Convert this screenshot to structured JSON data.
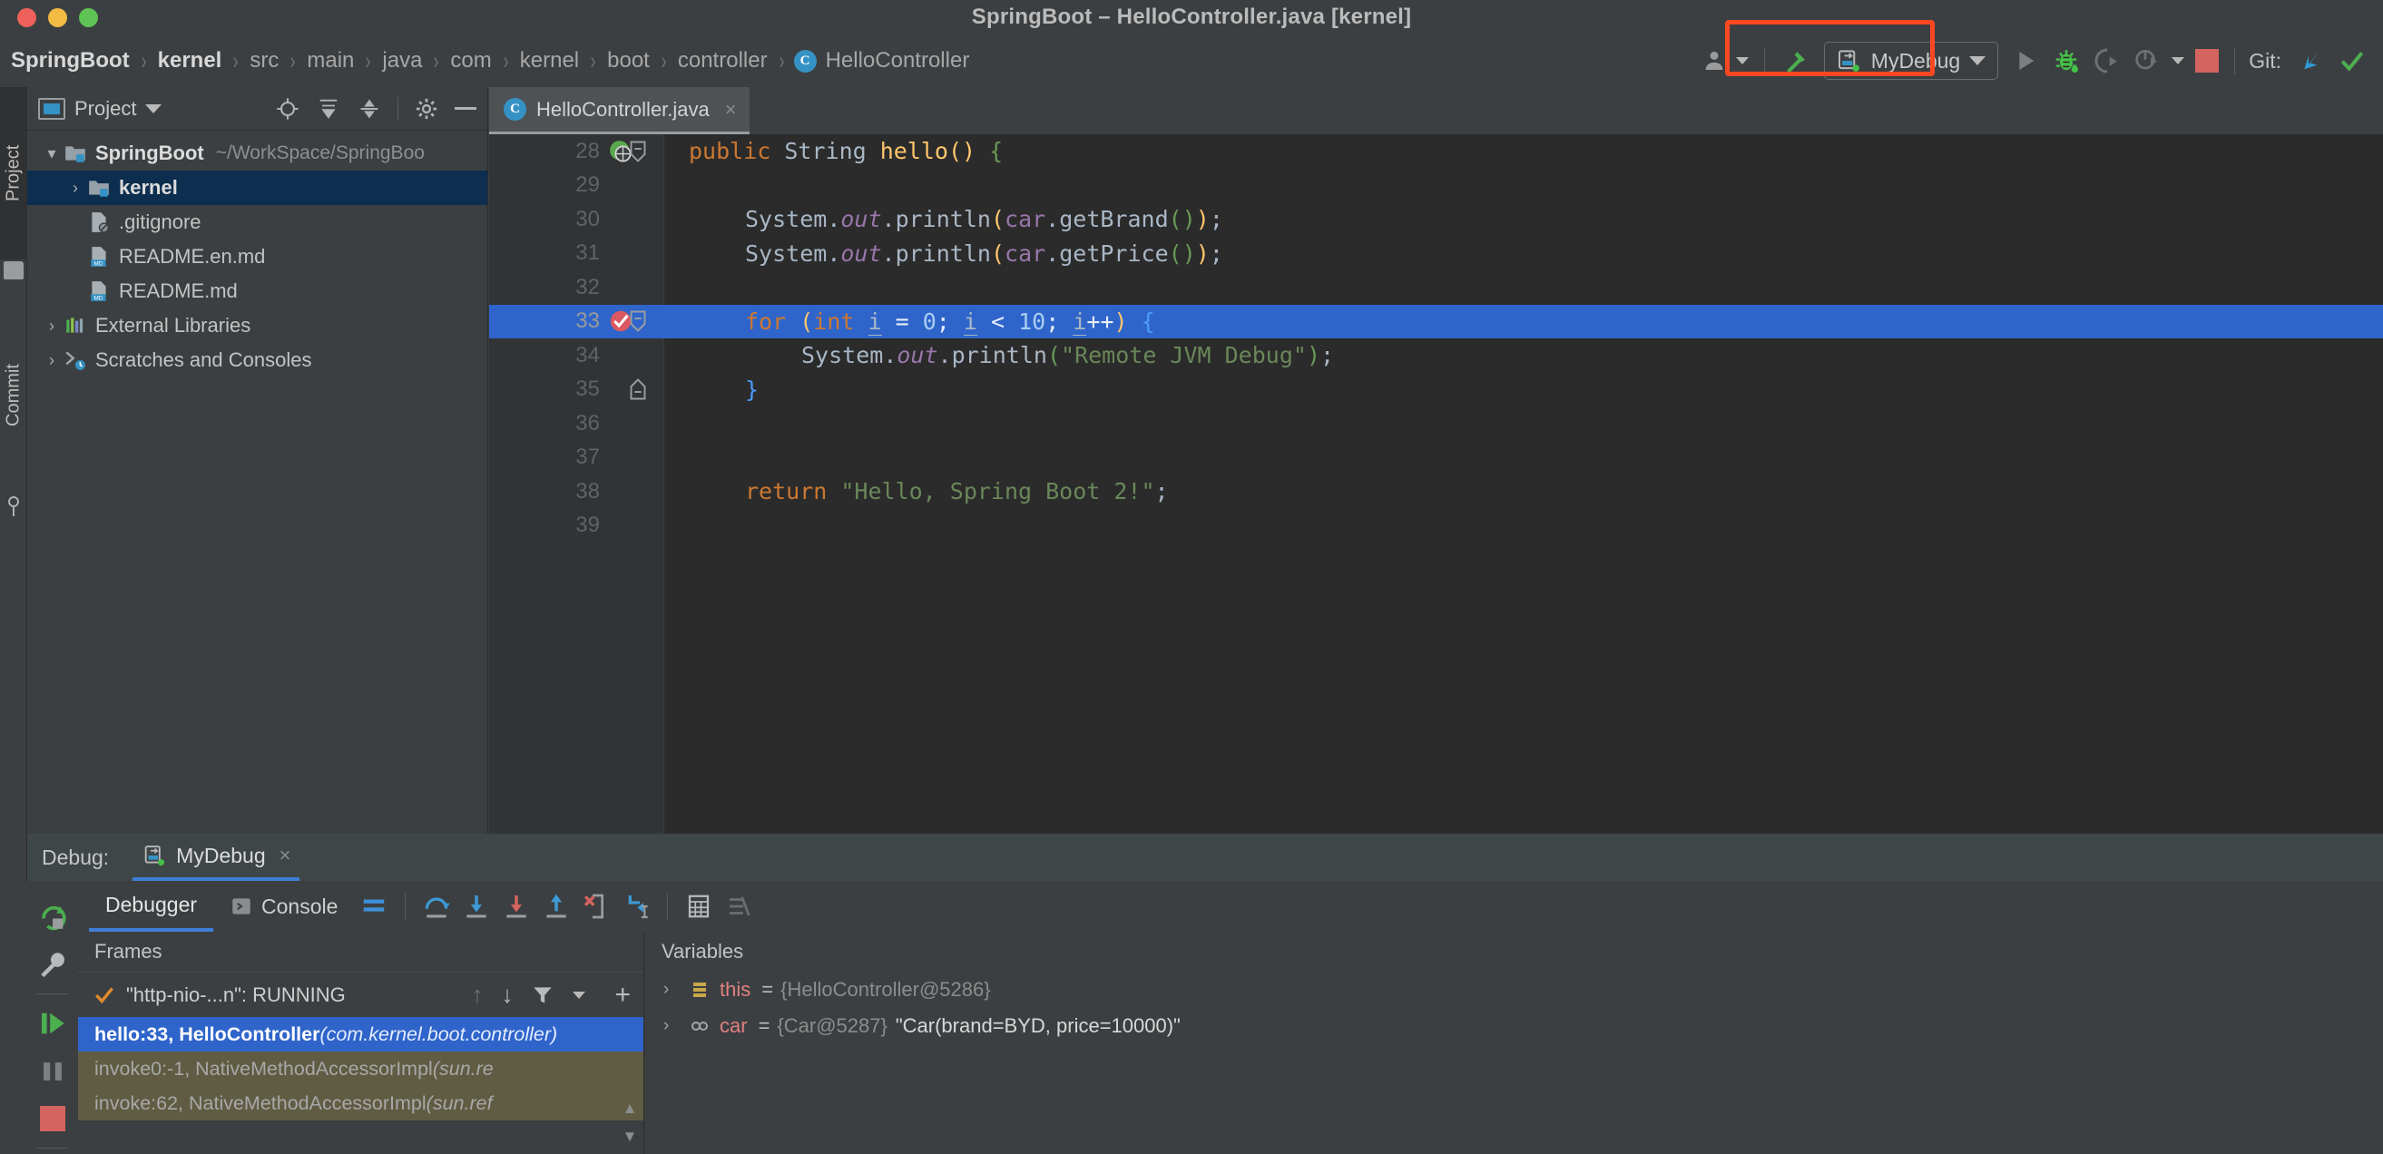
{
  "window": {
    "title": "SpringBoot – HelloController.java [kernel]",
    "traffic_lights": [
      "close-red",
      "minimize-yellow",
      "maximize-green"
    ]
  },
  "breadcrumb": {
    "separator": "›",
    "items": [
      {
        "label": "SpringBoot",
        "strong": true
      },
      {
        "label": "kernel",
        "strong": true
      },
      {
        "label": "src",
        "strong": false
      },
      {
        "label": "main",
        "strong": false
      },
      {
        "label": "java",
        "strong": false
      },
      {
        "label": "com",
        "strong": false
      },
      {
        "label": "kernel",
        "strong": false
      },
      {
        "label": "boot",
        "strong": false
      },
      {
        "label": "controller",
        "strong": false
      },
      {
        "label": "HelloController",
        "strong": false,
        "badge": "C"
      }
    ]
  },
  "toolbar": {
    "icons": [
      "user-avatar-icon",
      "chevron-down-icon",
      "build-hammer-icon"
    ],
    "run_config": {
      "name": "MyDebug",
      "icon": "remote-jvm-debug-icon",
      "dropdown": "chevron-down-icon"
    },
    "run_button": "run-icon",
    "debug_button": "debug-bug-icon",
    "run_with_coverage_button": "run-coverage-icon",
    "profiler_button": "profiler-icon",
    "profiler_dropdown": "chevron-down-icon",
    "stop_button": "stop-icon",
    "git": {
      "label": "Git:",
      "update_project": "update-project-icon",
      "commit_check": "commit-check-icon"
    },
    "annotation_box_color": "#fb4722"
  },
  "left_strip": {
    "tabs": [
      {
        "label": "Project",
        "icon": "folder-icon",
        "active": true
      },
      {
        "label": "Commit",
        "icon": "commit-icon",
        "active": false
      }
    ]
  },
  "project_panel": {
    "title": "Project",
    "title_icon": "project-view-icon",
    "title_dropdown": "chevron-down-icon",
    "actions": [
      "locate-target-icon",
      "expand-all-icon",
      "collapse-all-icon",
      "gear-icon",
      "hide-minus-icon"
    ],
    "tree": [
      {
        "indent": 0,
        "arrow": "expanded",
        "icon": "module-folder-icon",
        "name": "SpringBoot",
        "bold": true,
        "path": "~/WorkSpace/SpringBoo",
        "selected": false
      },
      {
        "indent": 1,
        "arrow": "collapsed",
        "icon": "module-folder-icon",
        "name": "kernel",
        "bold": true,
        "path": "",
        "selected": true
      },
      {
        "indent": 1,
        "arrow": "none",
        "icon": "gitignore-file-icon",
        "name": ".gitignore",
        "bold": false,
        "path": "",
        "selected": false
      },
      {
        "indent": 1,
        "arrow": "none",
        "icon": "markdown-file-icon",
        "name": "README.en.md",
        "bold": false,
        "path": "",
        "selected": false
      },
      {
        "indent": 1,
        "arrow": "none",
        "icon": "markdown-file-icon",
        "name": "README.md",
        "bold": false,
        "path": "",
        "selected": false
      },
      {
        "indent": 0,
        "arrow": "collapsed",
        "icon": "external-libraries-icon",
        "name": "External Libraries",
        "bold": false,
        "path": "",
        "selected": false
      },
      {
        "indent": 0,
        "arrow": "collapsed",
        "icon": "scratches-icon",
        "name": "Scratches and Consoles",
        "bold": false,
        "path": "",
        "selected": false
      }
    ]
  },
  "editor": {
    "tab": {
      "label": "HelloController.java",
      "badge": "C",
      "close": "×"
    },
    "lines": [
      {
        "no": "28",
        "indent": 0,
        "highlight": false,
        "gutter_icon": "web-endpoint-icon",
        "fold": "fold-collapse-icon",
        "tokens": [
          {
            "t": "public ",
            "c": "kw"
          },
          {
            "t": "String ",
            "c": "pln"
          },
          {
            "t": "hello",
            "c": "mth"
          },
          {
            "t": "()",
            "c": "br-y"
          },
          {
            "t": " ",
            "c": "pln"
          },
          {
            "t": "{",
            "c": "br-g"
          }
        ]
      },
      {
        "no": "29",
        "indent": 0,
        "highlight": false,
        "gutter_icon": "",
        "fold": "",
        "tokens": []
      },
      {
        "no": "30",
        "indent": 1,
        "highlight": false,
        "gutter_icon": "",
        "fold": "",
        "tokens": [
          {
            "t": "System",
            "c": "pln"
          },
          {
            "t": ".",
            "c": "pln"
          },
          {
            "t": "out",
            "c": "fld"
          },
          {
            "t": ".println",
            "c": "pln"
          },
          {
            "t": "(",
            "c": "br-y"
          },
          {
            "t": "car",
            "c": "id"
          },
          {
            "t": ".getBrand",
            "c": "pln"
          },
          {
            "t": "()",
            "c": "br-g"
          },
          {
            "t": ")",
            "c": "br-y"
          },
          {
            "t": ";",
            "c": "pln"
          }
        ]
      },
      {
        "no": "31",
        "indent": 1,
        "highlight": false,
        "gutter_icon": "",
        "fold": "",
        "tokens": [
          {
            "t": "System",
            "c": "pln"
          },
          {
            "t": ".",
            "c": "pln"
          },
          {
            "t": "out",
            "c": "fld"
          },
          {
            "t": ".println",
            "c": "pln"
          },
          {
            "t": "(",
            "c": "br-y"
          },
          {
            "t": "car",
            "c": "id"
          },
          {
            "t": ".getPrice",
            "c": "pln"
          },
          {
            "t": "()",
            "c": "br-g"
          },
          {
            "t": ")",
            "c": "br-y"
          },
          {
            "t": ";",
            "c": "pln"
          }
        ]
      },
      {
        "no": "32",
        "indent": 0,
        "highlight": false,
        "gutter_icon": "",
        "fold": "",
        "tokens": []
      },
      {
        "no": "33",
        "indent": 1,
        "highlight": true,
        "gutter_icon": "breakpoint-verified-icon",
        "fold": "fold-collapse-icon",
        "tokens": [
          {
            "t": "for ",
            "c": "kw"
          },
          {
            "t": "(",
            "c": "br-y"
          },
          {
            "t": "int ",
            "c": "kw"
          },
          {
            "t": "i",
            "c": "var-u"
          },
          {
            "t": " = ",
            "c": "pln"
          },
          {
            "t": "0",
            "c": "num"
          },
          {
            "t": "; ",
            "c": "pln"
          },
          {
            "t": "i",
            "c": "var-u"
          },
          {
            "t": " < ",
            "c": "pln"
          },
          {
            "t": "10",
            "c": "num"
          },
          {
            "t": "; ",
            "c": "pln"
          },
          {
            "t": "i",
            "c": "var-u"
          },
          {
            "t": "++",
            "c": "pln"
          },
          {
            "t": ")",
            "c": "br-y"
          },
          {
            "t": " ",
            "c": "pln"
          },
          {
            "t": "{",
            "c": "br-b"
          }
        ]
      },
      {
        "no": "34",
        "indent": 2,
        "highlight": false,
        "gutter_icon": "",
        "fold": "",
        "tokens": [
          {
            "t": "System",
            "c": "pln"
          },
          {
            "t": ".",
            "c": "pln"
          },
          {
            "t": "out",
            "c": "fld"
          },
          {
            "t": ".println",
            "c": "pln"
          },
          {
            "t": "(",
            "c": "br-g"
          },
          {
            "t": "\"Remote JVM Debug\"",
            "c": "str"
          },
          {
            "t": ")",
            "c": "br-g"
          },
          {
            "t": ";",
            "c": "pln"
          }
        ]
      },
      {
        "no": "35",
        "indent": 1,
        "highlight": false,
        "gutter_icon": "",
        "fold": "fold-end-icon",
        "tokens": [
          {
            "t": "}",
            "c": "br-b"
          }
        ]
      },
      {
        "no": "36",
        "indent": 0,
        "highlight": false,
        "gutter_icon": "",
        "fold": "",
        "tokens": []
      },
      {
        "no": "37",
        "indent": 0,
        "highlight": false,
        "gutter_icon": "",
        "fold": "",
        "tokens": []
      },
      {
        "no": "38",
        "indent": 1,
        "highlight": false,
        "gutter_icon": "",
        "fold": "",
        "tokens": [
          {
            "t": "return ",
            "c": "kw"
          },
          {
            "t": "\"Hello, Spring Boot 2!\"",
            "c": "str"
          },
          {
            "t": ";",
            "c": "pln"
          }
        ]
      },
      {
        "no": "39",
        "indent": 0,
        "highlight": false,
        "gutter_icon": "",
        "fold": "",
        "tokens": []
      }
    ]
  },
  "debug": {
    "header_label": "Debug:",
    "session_tab": {
      "label": "MyDebug",
      "icon": "remote-jvm-debug-icon",
      "close": "×"
    },
    "side_actions": [
      "rerun-icon",
      "settings-wrench-icon",
      "resume-program-icon",
      "pause-program-icon",
      "stop-icon"
    ],
    "tabs": [
      {
        "label": "Debugger",
        "icon": "",
        "active": true
      },
      {
        "label": "Console",
        "icon": "console-icon",
        "active": false
      }
    ],
    "toolbar_icons": [
      "layout-settings-icon",
      "step-over-icon",
      "step-into-icon",
      "force-step-into-icon",
      "step-out-icon",
      "drop-frame-icon",
      "run-to-cursor-icon",
      "evaluate-expression-icon",
      "mute-breakpoints-icon"
    ],
    "frames": {
      "title": "Frames",
      "thread": "\"http-nio-...n\": RUNNING",
      "thread_state_icon": "thread-running-check-icon",
      "controls": [
        "arrow-up-icon",
        "arrow-down-icon",
        "filter-icon",
        "chevron-down-icon",
        "plus-icon"
      ],
      "rows": [
        {
          "text": "hello:33, HelloController ",
          "em": "(com.kernel.boot.controller)",
          "selected": true,
          "dim": false
        },
        {
          "text": "invoke0:-1, NativeMethodAccessorImpl ",
          "em": "(sun.re",
          "selected": false,
          "dim": true
        },
        {
          "text": "invoke:62, NativeMethodAccessorImpl ",
          "em": "(sun.ref",
          "selected": false,
          "dim": true
        }
      ],
      "scroll": {
        "up": "▲",
        "down": "▼"
      }
    },
    "variables": {
      "title": "Variables",
      "rows": [
        {
          "toggle": "›",
          "icon": "object-field-icon",
          "name": "this",
          "eq": "=",
          "ref": "{HelloController@5286}",
          "value": ""
        },
        {
          "toggle": "›",
          "icon": "object-ref-icon",
          "name": "car",
          "eq": "=",
          "ref": "{Car@5287}",
          "value": "\"Car(brand=BYD, price=10000)\""
        }
      ]
    }
  },
  "colors": {
    "accent_blue": "#3d7fd6",
    "selection_blue": "#2f65ca",
    "chrome_bg": "#3c3f41",
    "editor_bg": "#2b2b2b",
    "gutter_bg": "#313335",
    "annotation_red": "#fb4722"
  }
}
